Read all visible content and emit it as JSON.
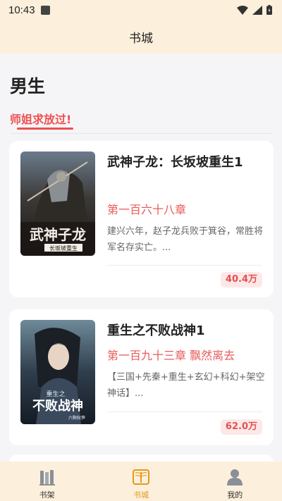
{
  "status_bar": {
    "time": "10:43"
  },
  "header": {
    "title": "书城"
  },
  "section": {
    "title": "男生",
    "subtab": "师姐求放过!"
  },
  "books": [
    {
      "title": "武神子龙：长坂坡重生1",
      "chapter": "第一百六十八章",
      "description": "建兴六年，赵子龙兵败于箕谷，常胜将军名存实亡。...",
      "count": "40.4万",
      "cover_lines": [
        "武神子龙",
        "长坂坡重生"
      ]
    },
    {
      "title": "重生之不败战神1",
      "chapter": "第一百九十三章 飘然离去",
      "description": "【三国+先秦+重生+玄幻+科幻+架空神话】...",
      "count": "62.0万",
      "cover_lines": [
        "重生之",
        "不败战神",
        "六颗秋笋"
      ]
    }
  ],
  "bottom_nav": [
    {
      "label": "书架",
      "icon": "bookshelf-icon",
      "active": false
    },
    {
      "label": "书城",
      "icon": "open-book-icon",
      "active": true
    },
    {
      "label": "我的",
      "icon": "person-icon",
      "active": false
    }
  ],
  "colors": {
    "accent": "#ee5050",
    "nav_active": "#e8961a",
    "header_bg": "#fcf0dc"
  }
}
